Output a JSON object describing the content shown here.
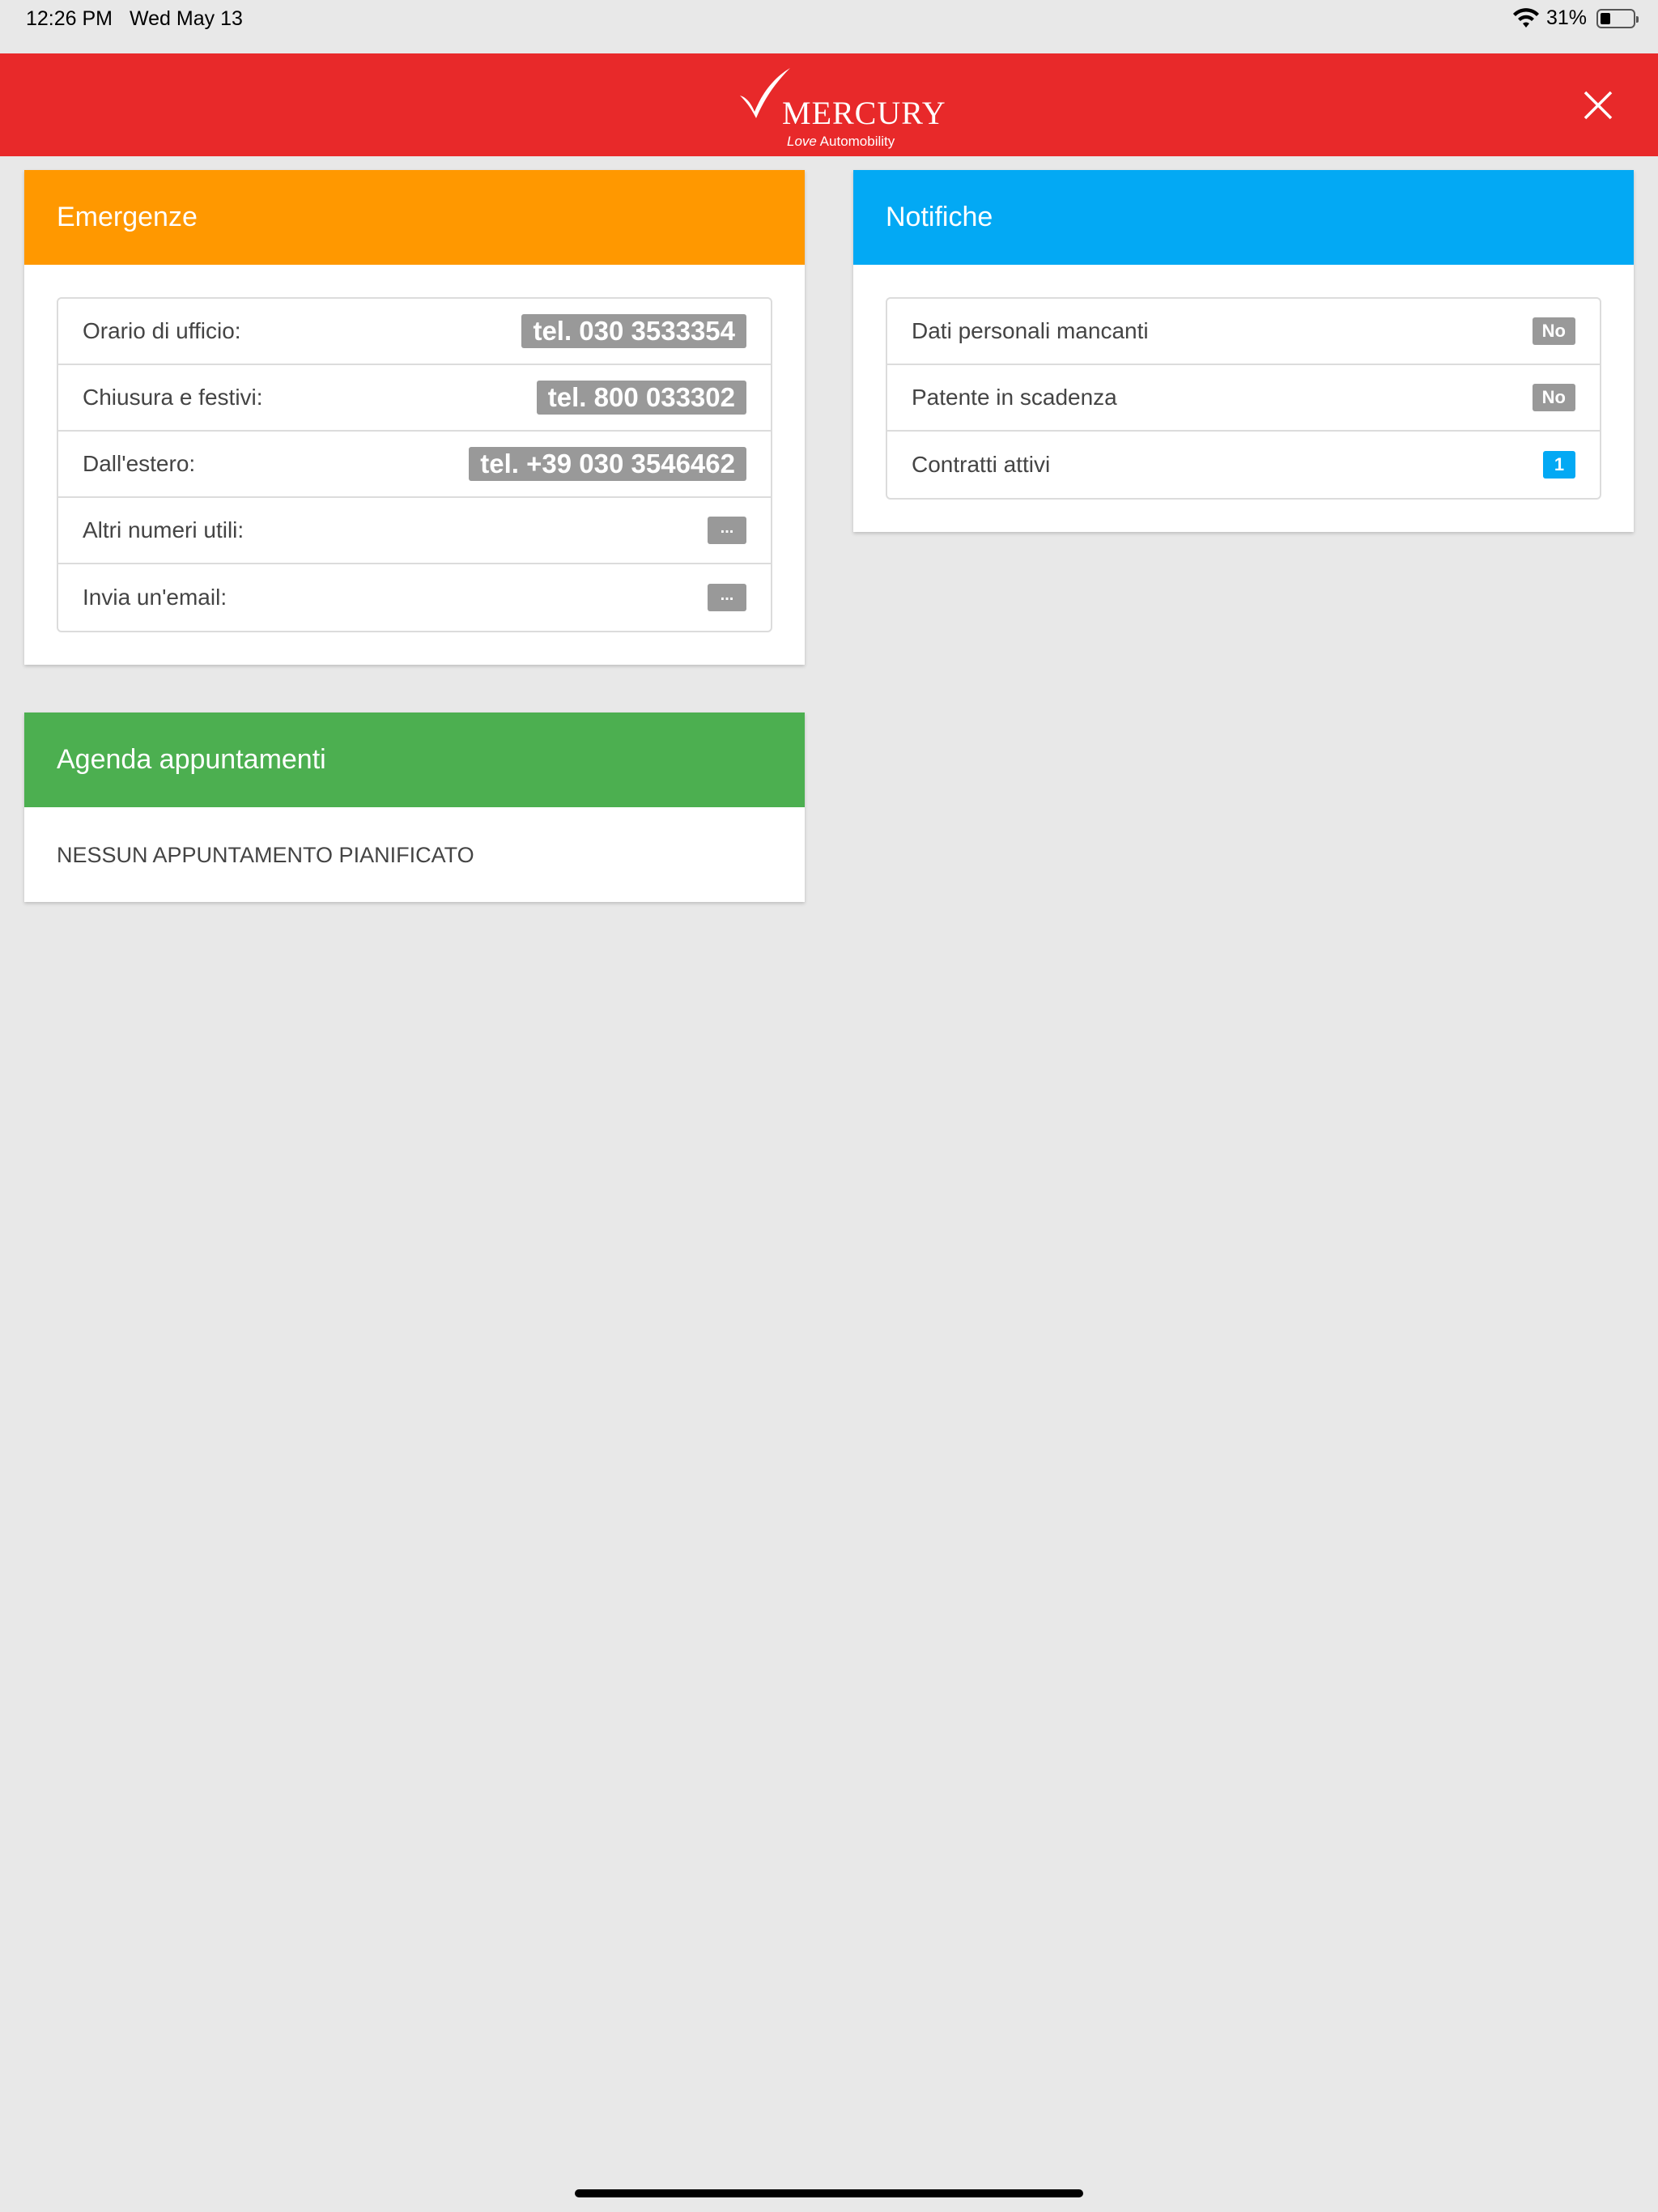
{
  "status_bar": {
    "time": "12:26 PM",
    "date": "Wed May 13",
    "battery_percent": "31%",
    "battery_level": 0.31
  },
  "header": {
    "brand": "MERCURY",
    "tagline_italic": "Love",
    "tagline_rest": "Automobility",
    "close_icon": "close-icon",
    "color": "#e8292a"
  },
  "emergenze": {
    "title": "Emergenze",
    "color": "#ff9800",
    "rows": [
      {
        "label": "Orario di ufficio:",
        "value": "tel. 030 3533354"
      },
      {
        "label": "Chiusura e festivi:",
        "value": "tel. 800 033302"
      },
      {
        "label": "Dall'estero:",
        "value": "tel. +39 030 3546462"
      },
      {
        "label": "Altri numeri utili:",
        "value": "..."
      },
      {
        "label": "Invia un'email:",
        "value": "..."
      }
    ]
  },
  "notifiche": {
    "title": "Notifiche",
    "color": "#03a9f4",
    "rows": [
      {
        "label": "Dati personali mancanti",
        "value": "No"
      },
      {
        "label": "Patente in scadenza",
        "value": "No"
      },
      {
        "label": "Contratti attivi",
        "value": "1"
      }
    ]
  },
  "agenda": {
    "title": "Agenda appuntamenti",
    "color": "#4caf50",
    "empty_text": "NESSUN APPUNTAMENTO PIANIFICATO"
  }
}
